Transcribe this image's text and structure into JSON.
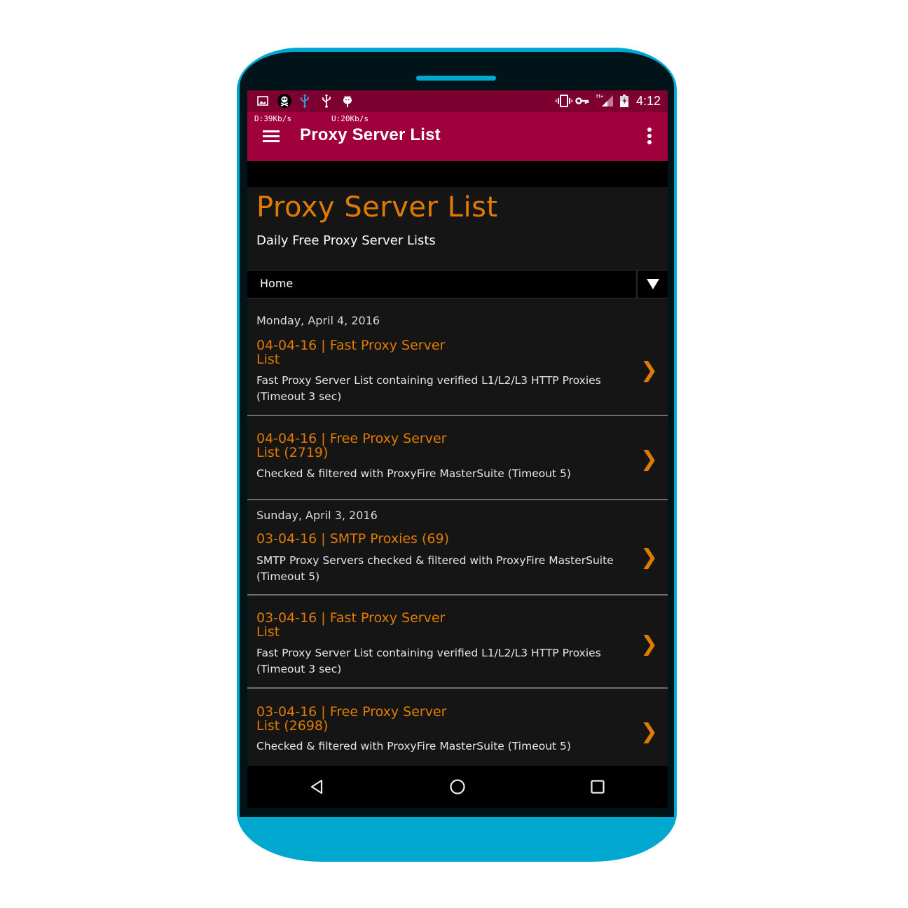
{
  "status_bar": {
    "left_icons": [
      "image-icon",
      "pirate-skull-icon",
      "usb-icon",
      "usb-icon",
      "android-icon"
    ],
    "right_icons": [
      "vibrate-icon",
      "vpn-key-icon",
      "signal-icon",
      "battery-charging-icon"
    ],
    "network_type": "H+",
    "time": "4:12"
  },
  "app_bar": {
    "download_speed": "D:39Kb/s",
    "upload_speed": "U:20Kb/s",
    "title": "Proxy Server List",
    "menu_icon": "hamburger-icon",
    "overflow_icon": "more-vert-icon"
  },
  "site": {
    "title": "Proxy Server List",
    "subtitle": "Daily Free Proxy Server Lists"
  },
  "nav": {
    "selected": "Home",
    "toggle_icon": "triangle-down-icon"
  },
  "posts": [
    {
      "date": "Monday, April 4, 2016",
      "title_line1": "04-04-16 | Fast Proxy Server",
      "title_line2": "List",
      "description": "Fast Proxy Server List containing verified L1/L2/L3 HTTP Proxies (Timeout 3 sec)"
    },
    {
      "date": "",
      "title_line1": "04-04-16 | Free Proxy Server",
      "title_line2": "List (2719)",
      "description": "Checked & filtered with ProxyFire MasterSuite (Timeout 5)"
    },
    {
      "date": "Sunday, April 3, 2016",
      "title_line1": "03-04-16 | SMTP Proxies (69)",
      "title_line2": "",
      "description": "SMTP Proxy Servers checked & filtered with ProxyFire MasterSuite (Timeout 5)"
    },
    {
      "date": "",
      "title_line1": "03-04-16 | Fast Proxy Server",
      "title_line2": "List",
      "description": "Fast Proxy Server List containing verified L1/L2/L3 HTTP Proxies (Timeout 3 sec)"
    },
    {
      "date": "",
      "title_line1": "03-04-16 | Free Proxy Server",
      "title_line2": "List (2698)",
      "description": "Checked & filtered with ProxyFire MasterSuite (Timeout 5)"
    }
  ],
  "chevron": "❯",
  "system_nav": {
    "back": "back-icon",
    "home": "home-icon",
    "recents": "recents-icon"
  },
  "colors": {
    "status_bar": "#7e0030",
    "app_bar": "#a0003b",
    "accent": "#e07b00",
    "background": "#151515",
    "phone_frame": "#00a8d0"
  }
}
